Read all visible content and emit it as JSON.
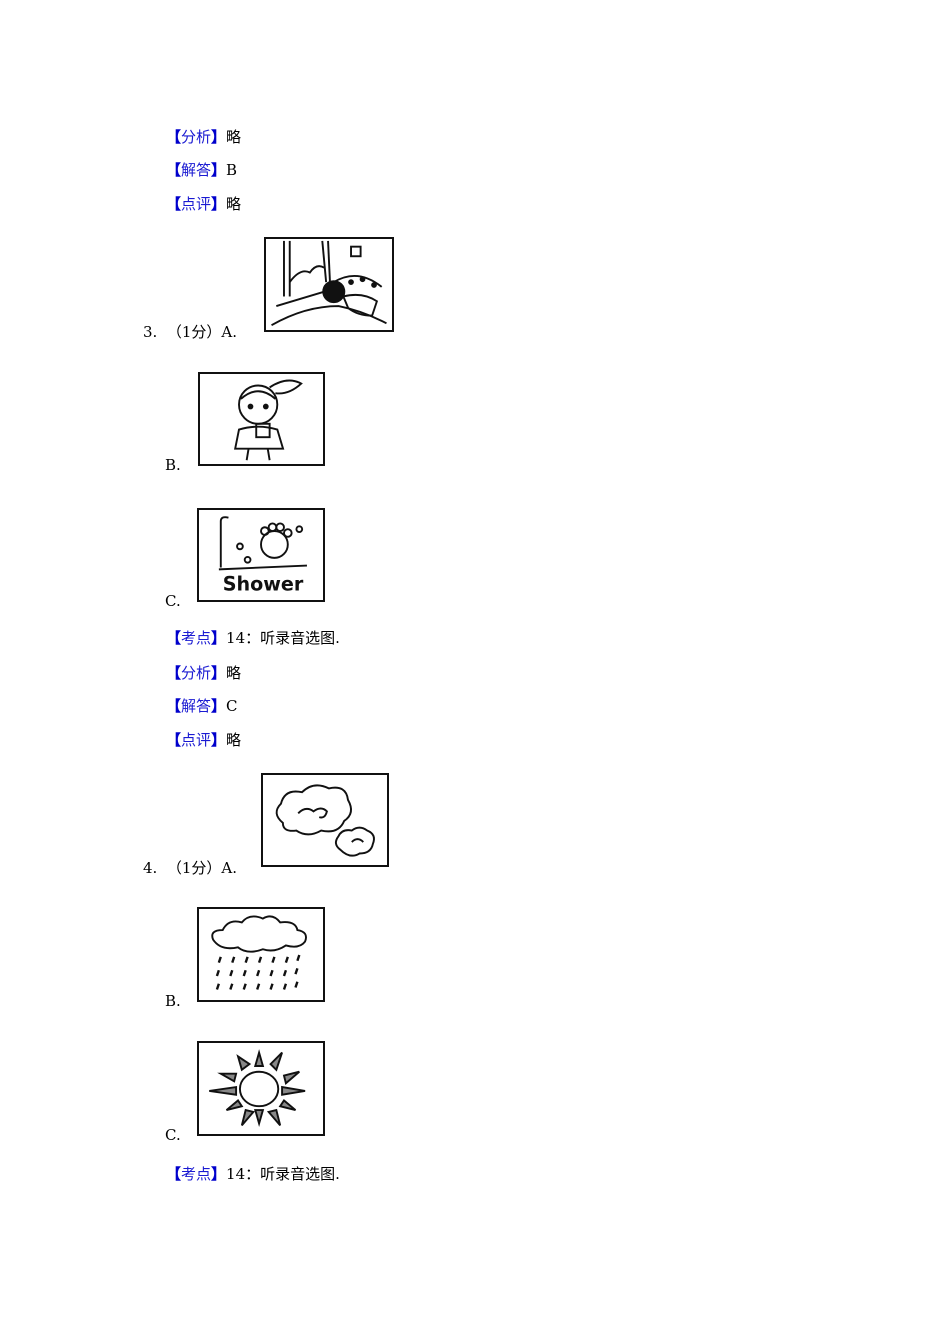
{
  "section_q2_tail": {
    "analysis": {
      "tag": "分析",
      "text": "略"
    },
    "answer": {
      "tag": "解答",
      "text": "B"
    },
    "comment": {
      "tag": "点评",
      "text": "略"
    }
  },
  "questions": [
    {
      "number": "3.",
      "score": "（1分）",
      "options": [
        {
          "label": "A.",
          "image": "boy-sleeping-in-bed-icon"
        },
        {
          "label": "B.",
          "image": "girl-brushing-teeth-icon"
        },
        {
          "label": "C.",
          "image": "boy-taking-shower-icon",
          "image_text": "Shower"
        }
      ],
      "keypoint": {
        "tag": "考点",
        "text": "14：听录音选图."
      },
      "analysis": {
        "tag": "分析",
        "text": "略"
      },
      "answer": {
        "tag": "解答",
        "text": "C"
      },
      "comment": {
        "tag": "点评",
        "text": "略"
      }
    },
    {
      "number": "4.",
      "score": "（1分）",
      "options": [
        {
          "label": "A.",
          "image": "cloudy-weather-icon"
        },
        {
          "label": "B.",
          "image": "rainy-weather-icon"
        },
        {
          "label": "C.",
          "image": "sunny-weather-icon"
        }
      ],
      "keypoint": {
        "tag": "考点",
        "text": "14：听录音选图."
      }
    }
  ],
  "colors": {
    "tag": "#1a1ad2",
    "bracket": "#0000cc",
    "text": "#000000"
  }
}
